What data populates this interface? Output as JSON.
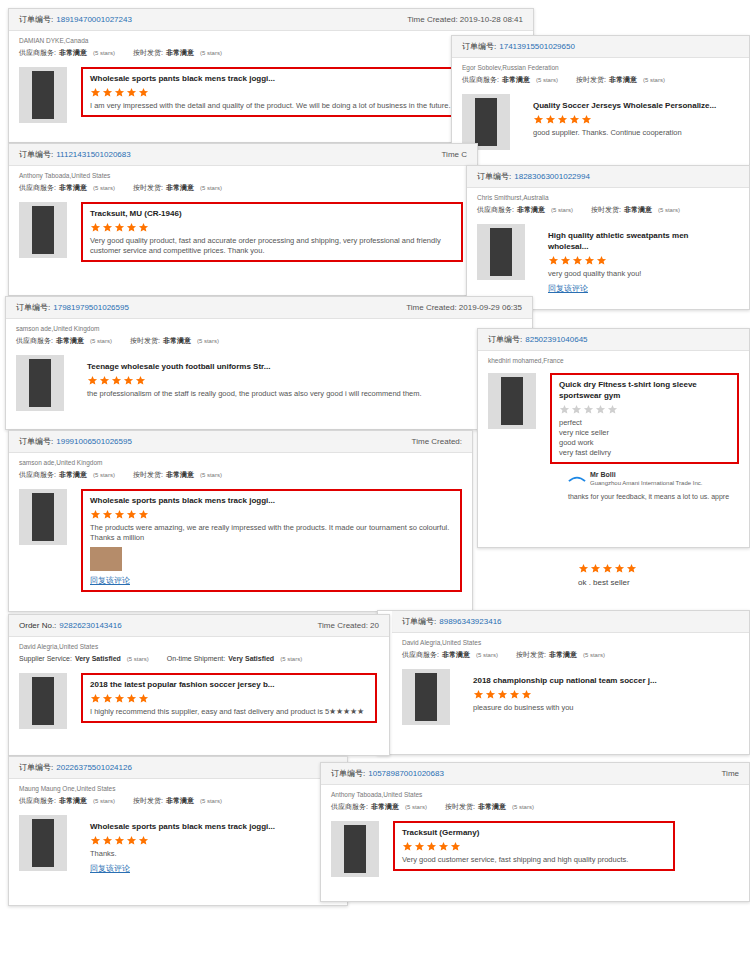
{
  "cards": [
    {
      "kind": "review",
      "order_label": "订单编号:",
      "order_no": "18919470001027243",
      "time": "Time Created: 2019-10-28 08:41",
      "customer": "DAMIAN DYKE,Canada",
      "ratings": [
        {
          "label": "供应商服务:",
          "value": "非常满意",
          "note": "(5 stars)"
        },
        {
          "label": "按时发货:",
          "value": "非常满意",
          "note": "(5 stars)"
        }
      ],
      "product": "Wholesale sports pants black mens track joggi...",
      "stars": 5,
      "review": [
        "I am very impressed with the detail and quality of the product. We will be doing a lot of business in the future."
      ],
      "highlighted": true,
      "has_photo": false
    },
    {
      "kind": "review",
      "order_label": "订单编号:",
      "order_no": "17413915501029650",
      "customer": "Egor Sobolev,Russian Federation",
      "ratings": [
        {
          "label": "供应商服务:",
          "value": "非常满意",
          "note": "(5 stars)"
        },
        {
          "label": "按时发货:",
          "value": "非常满意",
          "note": "(5 stars)"
        }
      ],
      "product": "Quality Soccer Jerseys Wholesale Personalize...",
      "stars": 5,
      "review": [
        "good supplier. Thanks. Continue cooperation"
      ],
      "highlighted": false,
      "has_photo": false
    },
    {
      "kind": "review",
      "order_label": "订单编号:",
      "order_no": "11121431501020683",
      "time": "Time C",
      "customer": "Anthony Taboada,United States",
      "ratings": [
        {
          "label": "供应商服务:",
          "value": "非常满意",
          "note": "(5 stars)"
        },
        {
          "label": "按时发货:",
          "value": "非常满意",
          "note": "(5 stars)"
        }
      ],
      "product": "Tracksuit, MU (CR-1946)",
      "stars": 5,
      "review": [
        "Very good quality product, fast and accurate order processing and shipping, very professional and friendly customer service and competitive prices. Thank you."
      ],
      "highlighted": true,
      "has_photo": false
    },
    {
      "kind": "review",
      "order_label": "订单编号:",
      "order_no": "18283063001022994",
      "customer": "Chris Smithurst,Australia",
      "ratings": [
        {
          "label": "供应商服务:",
          "value": "非常满意",
          "note": "(5 stars)"
        },
        {
          "label": "按时发货:",
          "value": "非常满意",
          "note": "(5 stars)"
        }
      ],
      "product": "High quality athletic sweatpants men wholesal...",
      "stars": 5,
      "review": [
        "very good quality thank you!"
      ],
      "highlighted": false,
      "has_photo": false,
      "reply_link": "回复该评论"
    },
    {
      "kind": "review",
      "order_label": "订单编号:",
      "order_no": "17981979501026595",
      "time": "Time Created: 2019-09-29 06:35",
      "customer": "samson ade,United Kingdom",
      "ratings": [
        {
          "label": "供应商服务:",
          "value": "非常满意",
          "note": "(5 stars)"
        },
        {
          "label": "按时发货:",
          "value": "非常满意",
          "note": "(5 stars)"
        }
      ],
      "product": "Teenage wholesale youth football uniforms Str...",
      "stars": 5,
      "review": [
        "the professionalism of the staff is really good, the product was also very good i will recommend them."
      ],
      "highlighted": false,
      "has_photo": false
    },
    {
      "kind": "review",
      "order_label": "订单编号:",
      "order_no": "82502391040645",
      "customer": "khedhiri mohamed,France",
      "ratings": [],
      "product": "Quick dry Fitness t-shirt long sleeve sportswear gym",
      "stars": 0,
      "review": [
        "perfect",
        "very nice seller",
        "good work",
        "very fast delivry"
      ],
      "highlighted": true,
      "has_photo": false,
      "reply": {
        "name": "Mr Bolli",
        "company": "Guangzhou Amani International Trade Inc.",
        "text": "thanks for your feedback, it means a lot to us. appre"
      }
    },
    {
      "kind": "review",
      "order_label": "订单编号:",
      "order_no": "19991006501026595",
      "time": "Time Created:",
      "customer": "samson ade,United Kingdom",
      "ratings": [
        {
          "label": "供应商服务:",
          "value": "非常满意",
          "note": "(5 stars)"
        },
        {
          "label": "按时发货:",
          "value": "非常满意",
          "note": "(5 stars)"
        }
      ],
      "product": "Wholesale sports pants black mens track joggi...",
      "stars": 5,
      "review": [
        "The products were amazing, we are really impressed with the products. It made our tournament so colourful. Thanks a million"
      ],
      "highlighted": true,
      "has_photo": true,
      "reply_link": "回复该评论"
    },
    {
      "kind": "snippet",
      "stars": 5,
      "review": [
        "ok . best seller"
      ]
    },
    {
      "kind": "review",
      "order_label": "订单编号:",
      "order_no": "89896343923416",
      "customer": "David Alegria,United States",
      "ratings": [
        {
          "label": "供应商服务:",
          "value": "非常满意",
          "note": "(5 stars)"
        },
        {
          "label": "按时发货:",
          "value": "非常满意",
          "note": "(5 stars)"
        }
      ],
      "product": "2018 championship cup national team soccer j...",
      "stars": 5,
      "review": [
        "pleasure do business with you"
      ],
      "highlighted": false,
      "has_photo": false
    },
    {
      "kind": "review",
      "order_label": "Order No.:",
      "order_no": "92826230143416",
      "time": "Time Created: 20",
      "customer": "David Alegria,United States",
      "ratings": [
        {
          "label": "Supplier Service:",
          "value": "Very Satisfied",
          "note": "(5 stars)"
        },
        {
          "label": "On-time Shipment:",
          "value": "Very Satisfied",
          "note": "(5 stars)"
        }
      ],
      "product": "2018 the latest popular fashion soccer jersey b...",
      "stars": 5,
      "review": [
        "I highly recommend this supplier, easy and fast delivery and product is 5★★★★★"
      ],
      "highlighted": true,
      "has_photo": false
    },
    {
      "kind": "review",
      "order_label": "订单编号:",
      "order_no": "20226375501024126",
      "customer": "Maung Maung One,United States",
      "ratings": [
        {
          "label": "供应商服务:",
          "value": "非常满意",
          "note": "(5 stars)"
        },
        {
          "label": "按时发货:",
          "value": "非常满意",
          "note": "(5 stars)"
        }
      ],
      "product": "Wholesale sports pants black mens track joggi...",
      "stars": 5,
      "review": [
        "Thanks."
      ],
      "highlighted": false,
      "has_photo": false,
      "reply_link": "回复该评论"
    },
    {
      "kind": "review",
      "order_label": "订单编号:",
      "order_no": "10578987001020683",
      "time": "Time",
      "customer": "Anthony Taboada,United States",
      "ratings": [
        {
          "label": "供应商服务:",
          "value": "非常满意",
          "note": "(5 stars)"
        },
        {
          "label": "按时发货:",
          "value": "非常满意",
          "note": "(5 stars)"
        }
      ],
      "product": "Tracksuit (Germany)",
      "stars": 5,
      "review": [
        "Very good customer service, fast shipping and high quality products."
      ],
      "highlighted": true,
      "has_photo": false
    }
  ]
}
